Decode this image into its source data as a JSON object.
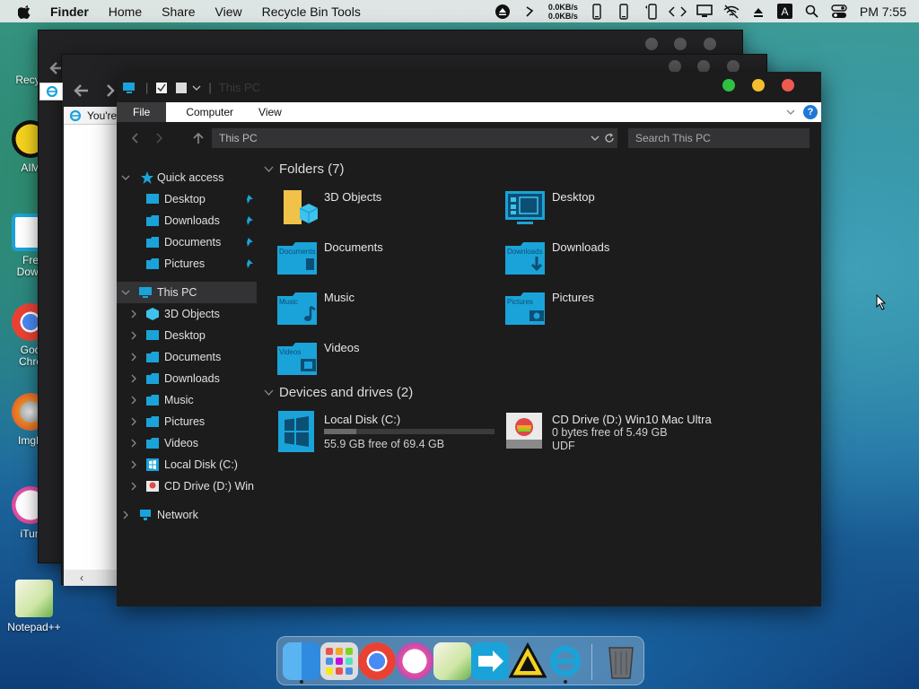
{
  "menubar": {
    "app": "Finder",
    "items": [
      "Home",
      "Share",
      "View",
      "Recycle Bin Tools"
    ],
    "net_up": "0.0KB/s",
    "net_down": "0.0KB/s",
    "clock": "PM 7:55"
  },
  "desktop": {
    "icons": [
      "Recyc",
      "AIM",
      "Fre\nDown",
      "Goo\nChro",
      "ImgB",
      "iTun",
      "Notepad++"
    ]
  },
  "bg_window": {
    "tab_text": "You're"
  },
  "window": {
    "title": "This PC",
    "ribbon_tabs": [
      "File",
      "Computer",
      "View"
    ],
    "help": "?",
    "address": "This PC",
    "search_placeholder": "Search This PC",
    "sidebar": {
      "quick_access": "Quick access",
      "quick_items": [
        "Desktop",
        "Downloads",
        "Documents",
        "Pictures"
      ],
      "this_pc": "This PC",
      "pc_items": [
        "3D Objects",
        "Desktop",
        "Documents",
        "Downloads",
        "Music",
        "Pictures",
        "Videos",
        "Local Disk (C:)",
        "CD Drive (D:) Win"
      ],
      "network": "Network"
    },
    "folders_header": "Folders (7)",
    "folders": [
      {
        "name": "3D Objects",
        "icon": "3d-objects-icon"
      },
      {
        "name": "Desktop",
        "icon": "desktop-folder-icon"
      },
      {
        "name": "Documents",
        "icon": "documents-folder-icon",
        "tag": "Documents"
      },
      {
        "name": "Downloads",
        "icon": "downloads-folder-icon",
        "tag": "Downloads"
      },
      {
        "name": "Music",
        "icon": "music-folder-icon",
        "tag": "Music"
      },
      {
        "name": "Pictures",
        "icon": "pictures-folder-icon",
        "tag": "Pictures"
      },
      {
        "name": "Videos",
        "icon": "videos-folder-icon",
        "tag": "Videos"
      }
    ],
    "drives_header": "Devices and drives (2)",
    "drives": [
      {
        "name": "Local Disk (C:)",
        "free": "55.9 GB free of 69.4 GB",
        "used_fraction": 0.19
      },
      {
        "name": "CD Drive (D:) Win10 Mac Ultra",
        "free": "0 bytes free of 5.49 GB",
        "fs": "UDF"
      }
    ]
  },
  "colors": {
    "folder_blue": "#1aa3d9",
    "close": "#ee5a4f",
    "minimize": "#f5be2e",
    "maximize": "#2dc043",
    "accent": "#1e78d8"
  }
}
